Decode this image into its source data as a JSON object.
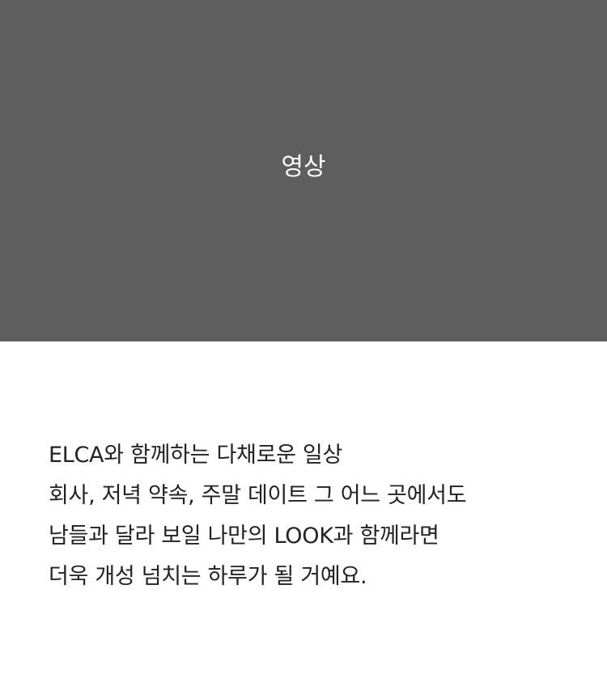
{
  "video": {
    "label": "영상"
  },
  "description": {
    "lines": [
      "ELCA와 함께하는 다채로운 일상",
      "회사, 저녁 약속, 주말 데이트 그 어느 곳에서도",
      "남들과 달라 보일 나만의 LOOK과 함께라면",
      "더욱 개성 넘치는 하루가 될 거예요."
    ]
  },
  "colors": {
    "video_background": "#5e5e5e",
    "video_label": "#ffffff",
    "text": "#222222",
    "page_background": "#ffffff"
  }
}
